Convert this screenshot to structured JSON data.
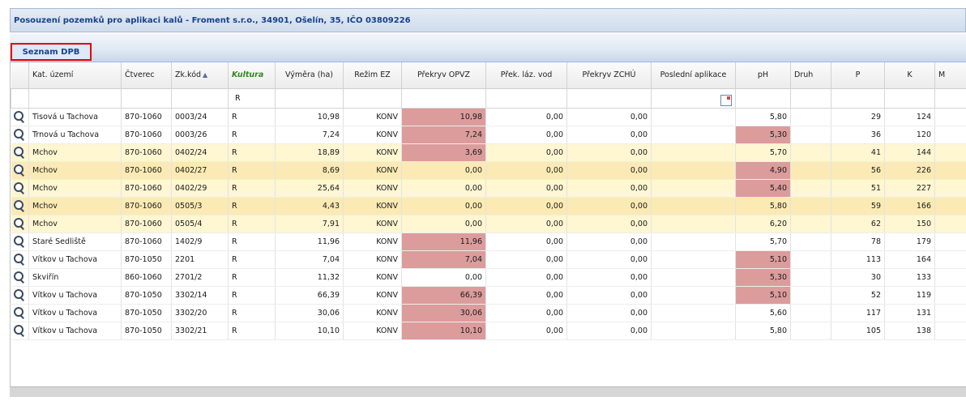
{
  "window": {
    "title": "Posouzení pozemků pro aplikaci kalů - Froment s.r.o., 34901, Ošelín, 35, IČO 03809226"
  },
  "tabs": [
    {
      "label": "Seznam DPB",
      "active": true
    }
  ],
  "grid": {
    "columns": [
      "",
      "Kat. území",
      "Čtverec",
      "Zk.kód",
      "Kultura",
      "Výměra (ha)",
      "Režim EZ",
      "Překryv OPVZ",
      "Přek. láz. vod",
      "Překryv ZCHÚ",
      "Poslední aplikace",
      "pH",
      "Druh",
      "P",
      "K",
      "M"
    ],
    "filter": {
      "kultura": "R"
    },
    "rows": [
      {
        "kat": "Tisová u Tachova",
        "ctverec": "870-1060",
        "zk": "0003/24",
        "kultura": "R",
        "vymera": "10,98",
        "rezim": "KONV",
        "opvz": "10,98",
        "laz": "0,00",
        "zchu": "0,00",
        "posledni": "",
        "ph": "5,80",
        "druh": "",
        "p": "29",
        "k": "124"
      },
      {
        "kat": "Trnová u Tachova",
        "ctverec": "870-1060",
        "zk": "0003/26",
        "kultura": "R",
        "vymera": "7,24",
        "rezim": "KONV",
        "opvz": "7,24",
        "laz": "0,00",
        "zchu": "0,00",
        "posledni": "",
        "ph": "5,30",
        "druh": "",
        "p": "36",
        "k": "120"
      },
      {
        "kat": "Mchov",
        "ctverec": "870-1060",
        "zk": "0402/24",
        "kultura": "R",
        "vymera": "18,89",
        "rezim": "KONV",
        "opvz": "3,69",
        "laz": "0,00",
        "zchu": "0,00",
        "posledni": "",
        "ph": "5,70",
        "druh": "",
        "p": "41",
        "k": "144"
      },
      {
        "kat": "Mchov",
        "ctverec": "870-1060",
        "zk": "0402/27",
        "kultura": "R",
        "vymera": "8,69",
        "rezim": "KONV",
        "opvz": "0,00",
        "laz": "0,00",
        "zchu": "0,00",
        "posledni": "",
        "ph": "4,90",
        "druh": "",
        "p": "56",
        "k": "226"
      },
      {
        "kat": "Mchov",
        "ctverec": "870-1060",
        "zk": "0402/29",
        "kultura": "R",
        "vymera": "25,64",
        "rezim": "KONV",
        "opvz": "0,00",
        "laz": "0,00",
        "zchu": "0,00",
        "posledni": "",
        "ph": "5,40",
        "druh": "",
        "p": "51",
        "k": "227"
      },
      {
        "kat": "Mchov",
        "ctverec": "870-1060",
        "zk": "0505/3",
        "kultura": "R",
        "vymera": "4,43",
        "rezim": "KONV",
        "opvz": "0,00",
        "laz": "0,00",
        "zchu": "0,00",
        "posledni": "",
        "ph": "5,80",
        "druh": "",
        "p": "59",
        "k": "166"
      },
      {
        "kat": "Mchov",
        "ctverec": "870-1060",
        "zk": "0505/4",
        "kultura": "R",
        "vymera": "7,91",
        "rezim": "KONV",
        "opvz": "0,00",
        "laz": "0,00",
        "zchu": "0,00",
        "posledni": "",
        "ph": "6,20",
        "druh": "",
        "p": "62",
        "k": "150"
      },
      {
        "kat": "Staré Sedliště",
        "ctverec": "870-1060",
        "zk": "1402/9",
        "kultura": "R",
        "vymera": "11,96",
        "rezim": "KONV",
        "opvz": "11,96",
        "laz": "0,00",
        "zchu": "0,00",
        "posledni": "",
        "ph": "5,70",
        "druh": "",
        "p": "78",
        "k": "179"
      },
      {
        "kat": "Vítkov u Tachova",
        "ctverec": "870-1050",
        "zk": "2201",
        "kultura": "R",
        "vymera": "7,04",
        "rezim": "KONV",
        "opvz": "7,04",
        "laz": "0,00",
        "zchu": "0,00",
        "posledni": "",
        "ph": "5,10",
        "druh": "",
        "p": "113",
        "k": "164"
      },
      {
        "kat": "Skviřín",
        "ctverec": "860-1060",
        "zk": "2701/2",
        "kultura": "R",
        "vymera": "11,32",
        "rezim": "KONV",
        "opvz": "0,00",
        "laz": "0,00",
        "zchu": "0,00",
        "posledni": "",
        "ph": "5,30",
        "druh": "",
        "p": "30",
        "k": "133"
      },
      {
        "kat": "Vítkov u Tachova",
        "ctverec": "870-1050",
        "zk": "3302/14",
        "kultura": "R",
        "vymera": "66,39",
        "rezim": "KONV",
        "opvz": "66,39",
        "laz": "0,00",
        "zchu": "0,00",
        "posledni": "",
        "ph": "5,10",
        "druh": "",
        "p": "52",
        "k": "119"
      },
      {
        "kat": "Vítkov u Tachova",
        "ctverec": "870-1050",
        "zk": "3302/20",
        "kultura": "R",
        "vymera": "30,06",
        "rezim": "KONV",
        "opvz": "30,06",
        "laz": "0,00",
        "zchu": "0,00",
        "posledni": "",
        "ph": "5,60",
        "druh": "",
        "p": "117",
        "k": "131"
      },
      {
        "kat": "Vítkov u Tachova",
        "ctverec": "870-1050",
        "zk": "3302/21",
        "kultura": "R",
        "vymera": "10,10",
        "rezim": "KONV",
        "opvz": "10,10",
        "laz": "0,00",
        "zchu": "0,00",
        "posledni": "",
        "ph": "5,80",
        "druh": "",
        "p": "105",
        "k": "138"
      }
    ]
  },
  "colors": {
    "highlight_red": "#dc9c9c",
    "row_highlight": "#fff6d2",
    "tab_outline": "#e60000",
    "title_text": "#15428b"
  }
}
